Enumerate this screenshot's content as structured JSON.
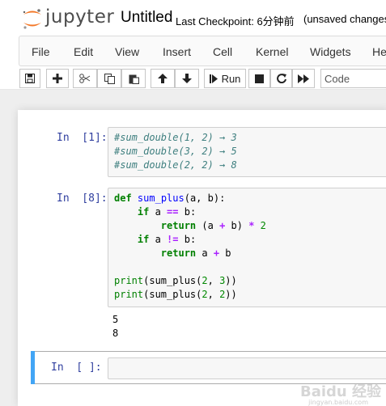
{
  "header": {
    "logo_text": "jupyter",
    "notebook_name": "Untitled",
    "checkpoint": "Last Checkpoint: 6分钟前",
    "unsaved": "(unsaved changes)"
  },
  "menu": [
    "File",
    "Edit",
    "View",
    "Insert",
    "Cell",
    "Kernel",
    "Widgets",
    "Help"
  ],
  "toolbar": {
    "run_label": "Run",
    "cell_type": "Code",
    "icons": [
      "save-icon",
      "add-cell-icon",
      "cut-icon",
      "copy-icon",
      "paste-icon",
      "move-up-icon",
      "move-down-icon",
      "run-icon",
      "stop-icon",
      "restart-icon",
      "fast-forward-icon"
    ]
  },
  "cells": [
    {
      "prompt": "In  [1]:",
      "lines": [
        "#sum_double(1, 2) → 3",
        "#sum_double(3, 2) → 5",
        "#sum_double(2, 2) → 8"
      ]
    },
    {
      "prompt": "In  [8]:",
      "lines": [
        "def sum_plus(a, b):",
        "    if a == b:",
        "        return (a + b) * 2",
        "    if a != b:",
        "        return a + b",
        "",
        "print(sum_plus(2, 3))",
        "print(sum_plus(2, 2))"
      ],
      "outputs": [
        "5",
        "8"
      ]
    },
    {
      "prompt": "In  [ ]:",
      "lines": []
    }
  ],
  "watermark": {
    "text": "Baidu 经验",
    "sub": "jingyan.baidu.com"
  },
  "colors": {
    "accent_orange": "#f37726",
    "prompt_blue": "#303f9f",
    "selected_bar": "#42a5f5"
  }
}
